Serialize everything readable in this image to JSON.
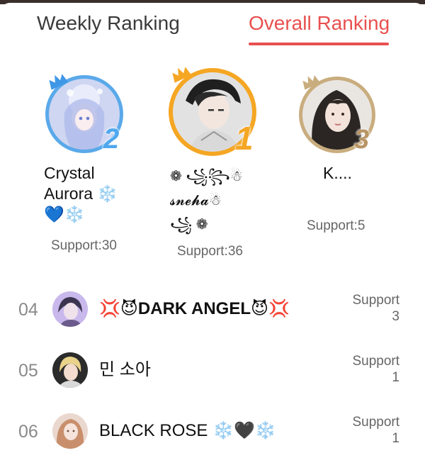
{
  "tabs": {
    "weekly": "Weekly Ranking",
    "overall": "Overall Ranking",
    "active": "overall"
  },
  "podium": [
    {
      "rank": "2",
      "name": "Crystal\nAurora ❄️\n💙❄️",
      "support": "Support:30"
    },
    {
      "rank": "1",
      "name": "❁ ꧁꧂☃︎\n𝓼𝓷𝓮𝓱𝓪☃︎\n꧁ ❁",
      "support": "Support:36"
    },
    {
      "rank": "3",
      "name": "K....",
      "support": "Support:5"
    }
  ],
  "list": [
    {
      "rank": "04",
      "name": "💢😈DARK ANGEL😈💢",
      "support_label": "Support",
      "support_value": "3"
    },
    {
      "rank": "05",
      "name": "민 소아",
      "support_label": "Support",
      "support_value": "1"
    },
    {
      "rank": "06",
      "name": "BLACK ROSE ❄️🖤❄️",
      "support_label": "Support",
      "support_value": "1"
    }
  ],
  "colors": {
    "accent": "#e8504f",
    "gold": "#f5a623",
    "silver_blue": "#4fa8ee",
    "bronze": "#c9ad7e"
  }
}
